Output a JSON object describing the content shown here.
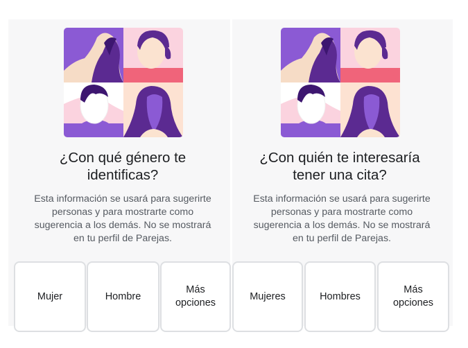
{
  "left_panel": {
    "illustration_icon": "people-collage-icon",
    "title_lines": [
      "¿Con qué género te",
      "identificas?"
    ],
    "description_lines": [
      "Esta información se usará para sugerirte",
      "personas y para mostrarte como",
      "sugerencia a los demás. No se mostrará",
      "en tu perfil de Parejas."
    ],
    "options": [
      {
        "lines": [
          "Mujer"
        ]
      },
      {
        "lines": [
          "Hombre"
        ]
      },
      {
        "lines": [
          "Más",
          "opciones"
        ]
      }
    ]
  },
  "right_panel": {
    "illustration_icon": "people-collage-icon",
    "title_lines": [
      "¿Con quién te interesaría",
      "tener una cita?"
    ],
    "description_lines": [
      "Esta información se usará para sugerirte",
      "personas y para mostrarte como",
      "sugerencia a los demás. No se mostrará",
      "en tu perfil de Parejas."
    ],
    "options": [
      {
        "lines": [
          "Mujeres"
        ]
      },
      {
        "lines": [
          "Hombres"
        ]
      },
      {
        "lines": [
          "Más",
          "opciones"
        ]
      }
    ]
  },
  "colors": {
    "purple_dark": "#5b2a91",
    "purple": "#8b5ad4",
    "pink_light": "#fbd3df",
    "coral": "#f0647a",
    "peach": "#fde2d2",
    "skin": "#fbe3d0"
  }
}
